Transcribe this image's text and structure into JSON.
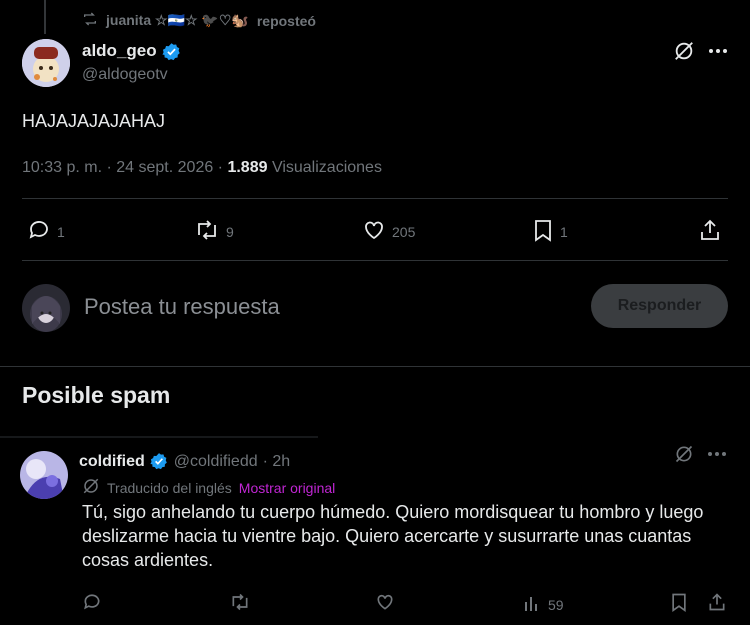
{
  "repost": {
    "reposter_name": "juanita ☆🇸🇻☆ 🐦‍⬛♡🐿️",
    "reposted_label": "reposteó"
  },
  "main_tweet": {
    "display_name": "aldo_geo",
    "handle": "@aldogeotv",
    "text": "HAJAJAJAJAHAJ",
    "time": "10:33 p. m. · 24 sept. 2026 · ",
    "views_count": "1.889",
    "views_label": " Visualizaciones",
    "replies": "1",
    "reposts": "9",
    "likes": "205",
    "bookmarks": "1"
  },
  "compose": {
    "placeholder": "Postea tu respuesta",
    "reply_button": "Responder"
  },
  "spam_section": {
    "title": "Posible spam"
  },
  "spam_tweet": {
    "display_name": "coldified",
    "handle": "@coldifiedd",
    "time": " · 2h",
    "translated_label": "Traducido del inglés",
    "show_original": "Mostrar original",
    "text": "Tú, sigo anhelando tu cuerpo húmedo. Quiero mordisquear tu hombro y luego deslizarme hacia tu vientre bajo. Quiero acercarte y susurrarte unas cuantas cosas ardientes.",
    "views": "59"
  },
  "colors": {
    "background": "#000000",
    "verified": "#1d9bf0",
    "muted": "#71767b",
    "show_original": "#c026d3"
  },
  "icons": [
    "repost-icon",
    "verified-icon",
    "grok-icon",
    "more-icon",
    "reply-icon",
    "like-icon",
    "bookmark-icon",
    "share-icon",
    "views-icon",
    "translate-icon"
  ]
}
